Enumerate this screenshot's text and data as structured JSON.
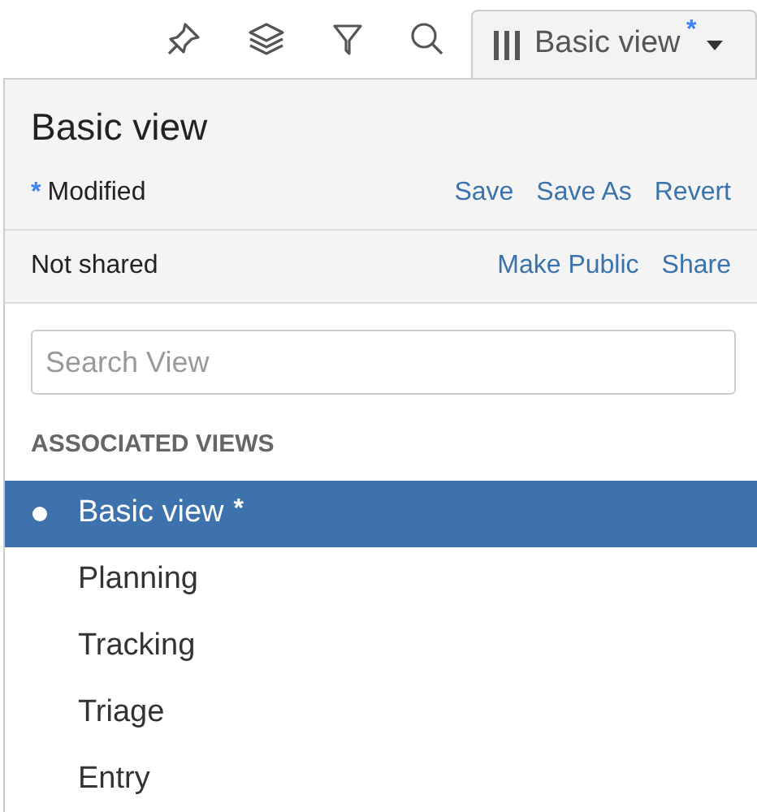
{
  "toolbar": {
    "icons": [
      {
        "kind": "pin"
      },
      {
        "kind": "layers"
      },
      {
        "kind": "filter"
      },
      {
        "kind": "search"
      }
    ],
    "view_button": {
      "label": "Basic view",
      "marker": "*"
    }
  },
  "panel": {
    "title": "Basic view",
    "status": {
      "marker": "*",
      "label": "Modified"
    },
    "status_actions": [
      "Save",
      "Save As",
      "Revert"
    ],
    "sharing": "Not shared",
    "sharing_actions": [
      "Make Public",
      "Share"
    ],
    "search": {
      "placeholder": "Search View"
    },
    "section_title": "ASSOCIATED VIEWS",
    "views": [
      {
        "label": "Basic view",
        "marker": "*",
        "selected": true
      },
      {
        "label": "Planning",
        "selected": false
      },
      {
        "label": "Tracking",
        "selected": false
      },
      {
        "label": "Triage",
        "selected": false
      },
      {
        "label": "Entry",
        "selected": false
      }
    ]
  }
}
